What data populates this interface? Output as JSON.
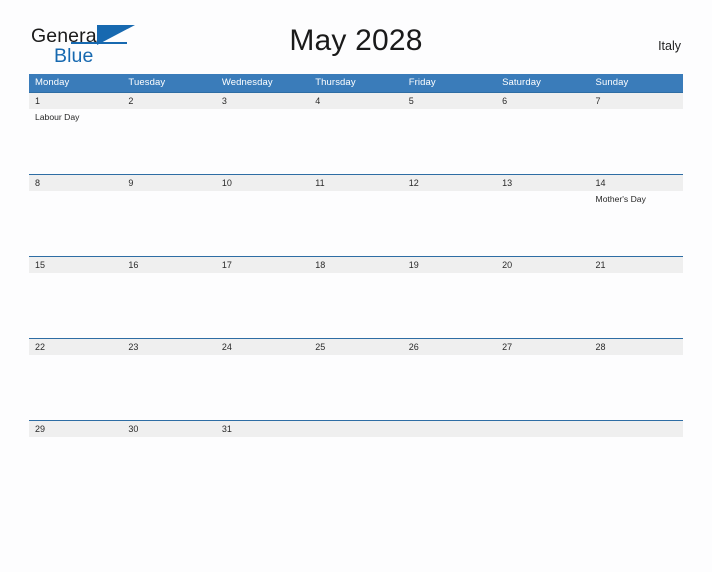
{
  "brand": {
    "name_part1": "General",
    "name_part2": "Blue",
    "flag_icon": "blue-triangle-flag",
    "accent_color": "#1769b0"
  },
  "header": {
    "title": "May 2028",
    "country": "Italy"
  },
  "colors": {
    "weekday_header_bg": "#3a7cba",
    "weekday_header_text": "#ffffff",
    "daynum_row_bg": "#efefef",
    "week_divider": "#2e6da4",
    "page_bg": "#fdfdfe",
    "text": "#262626"
  },
  "calendar": {
    "weekdays": [
      "Monday",
      "Tuesday",
      "Wednesday",
      "Thursday",
      "Friday",
      "Saturday",
      "Sunday"
    ],
    "weeks": [
      {
        "days": [
          {
            "num": "1",
            "event": "Labour Day"
          },
          {
            "num": "2",
            "event": ""
          },
          {
            "num": "3",
            "event": ""
          },
          {
            "num": "4",
            "event": ""
          },
          {
            "num": "5",
            "event": ""
          },
          {
            "num": "6",
            "event": ""
          },
          {
            "num": "7",
            "event": ""
          }
        ]
      },
      {
        "days": [
          {
            "num": "8",
            "event": ""
          },
          {
            "num": "9",
            "event": ""
          },
          {
            "num": "10",
            "event": ""
          },
          {
            "num": "11",
            "event": ""
          },
          {
            "num": "12",
            "event": ""
          },
          {
            "num": "13",
            "event": ""
          },
          {
            "num": "14",
            "event": "Mother's Day"
          }
        ]
      },
      {
        "days": [
          {
            "num": "15",
            "event": ""
          },
          {
            "num": "16",
            "event": ""
          },
          {
            "num": "17",
            "event": ""
          },
          {
            "num": "18",
            "event": ""
          },
          {
            "num": "19",
            "event": ""
          },
          {
            "num": "20",
            "event": ""
          },
          {
            "num": "21",
            "event": ""
          }
        ]
      },
      {
        "days": [
          {
            "num": "22",
            "event": ""
          },
          {
            "num": "23",
            "event": ""
          },
          {
            "num": "24",
            "event": ""
          },
          {
            "num": "25",
            "event": ""
          },
          {
            "num": "26",
            "event": ""
          },
          {
            "num": "27",
            "event": ""
          },
          {
            "num": "28",
            "event": ""
          }
        ]
      },
      {
        "days": [
          {
            "num": "29",
            "event": ""
          },
          {
            "num": "30",
            "event": ""
          },
          {
            "num": "31",
            "event": ""
          },
          {
            "num": "",
            "event": ""
          },
          {
            "num": "",
            "event": ""
          },
          {
            "num": "",
            "event": ""
          },
          {
            "num": "",
            "event": ""
          }
        ]
      }
    ]
  }
}
